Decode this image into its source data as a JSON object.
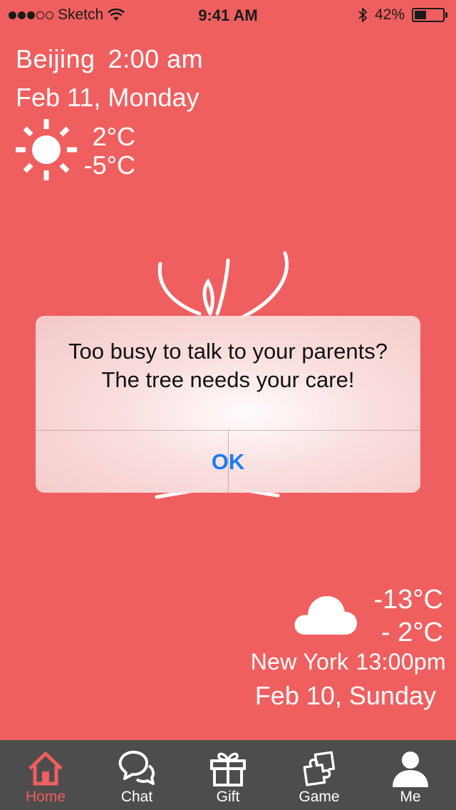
{
  "status_bar": {
    "carrier": "Sketch",
    "time": "9:41 AM",
    "battery_text": "42%",
    "battery_level": 0.42,
    "signal_bars_filled": 3,
    "signal_bars_total": 5
  },
  "local_weather": {
    "city": "Beijing",
    "time": "2:00 am",
    "date": "Feb 11, Monday",
    "high": "2°C",
    "low": "-5°C",
    "icon": "sun-icon"
  },
  "alert": {
    "message": "Too busy to talk to your parents? The tree needs your care!",
    "ok_label": "OK"
  },
  "remote_weather": {
    "high": "-13°C",
    "low": "- 2°C",
    "city": "New York",
    "time": "13:00pm",
    "date": "Feb 10, Sunday",
    "icon": "cloud-icon"
  },
  "tabs": [
    {
      "label": "Home",
      "icon": "home-icon",
      "active": true
    },
    {
      "label": "Chat",
      "icon": "chat-icon",
      "active": false
    },
    {
      "label": "Gift",
      "icon": "gift-icon",
      "active": false
    },
    {
      "label": "Game",
      "icon": "puzzle-icon",
      "active": false
    },
    {
      "label": "Me",
      "icon": "user-icon",
      "active": false
    }
  ],
  "colors": {
    "background": "#f05f5f",
    "tab_bar": "#4d4d4d",
    "active_tab": "#f05f5f",
    "alert_button": "#1a7cf0"
  }
}
